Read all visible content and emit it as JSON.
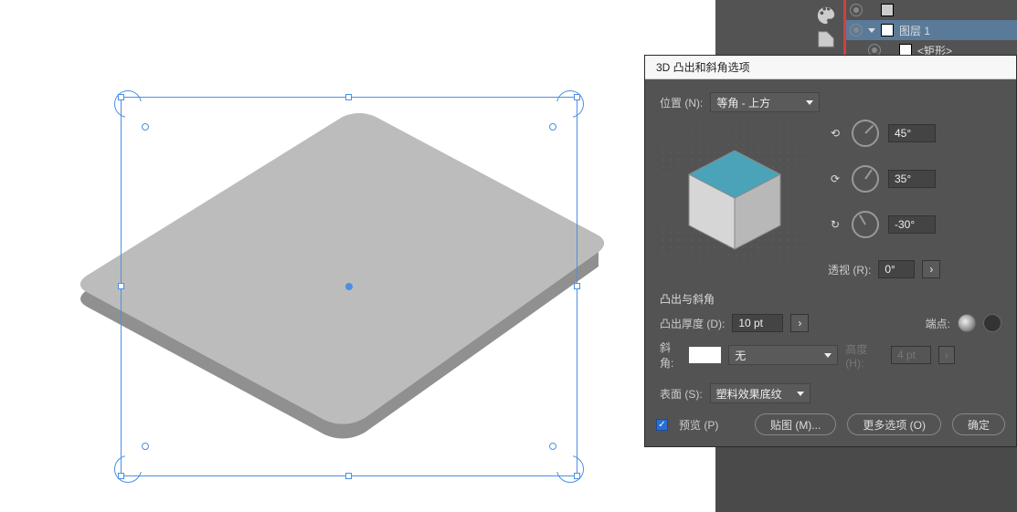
{
  "layers": {
    "item0": ".....",
    "item1": "图层 1",
    "item2": "<矩形>"
  },
  "dialog": {
    "title": "3D 凸出和斜角选项",
    "position_label": "位置 (N):",
    "position_value": "等角 - 上方",
    "rot_x": "45°",
    "rot_y": "35°",
    "rot_z": "-30°",
    "persp_label": "透视 (R):",
    "persp_value": "0°",
    "section_extrude": "凸出与斜角",
    "depth_label": "凸出厚度 (D):",
    "depth_value": "10 pt",
    "cap_label": "端点:",
    "bevel_label": "斜角:",
    "bevel_value": "无",
    "height_label": "高度 (H):",
    "height_value": "4 pt",
    "surface_label": "表面 (S):",
    "surface_value": "塑料效果底纹",
    "preview": "预览 (P)",
    "map_art": "贴图 (M)...",
    "more_options": "更多选项 (O)",
    "ok": "确定"
  }
}
